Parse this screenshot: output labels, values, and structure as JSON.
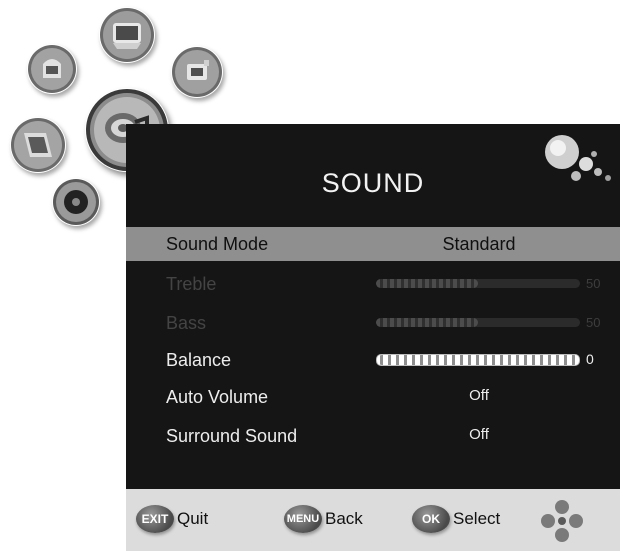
{
  "menu": {
    "title": "SOUND",
    "rows": [
      {
        "label": "Sound Mode",
        "value": "Standard"
      },
      {
        "label": "Treble",
        "value": "50",
        "level": 0.5
      },
      {
        "label": "Bass",
        "value": "50",
        "level": 0.5
      },
      {
        "label": "Balance",
        "value": "0",
        "level": 1.0
      },
      {
        "label": "Auto Volume",
        "value": "Off"
      },
      {
        "label": "Surround Sound",
        "value": "Off"
      }
    ]
  },
  "footer": {
    "exit": {
      "key": "EXIT",
      "label": "Quit"
    },
    "menu": {
      "key": "MENU",
      "label": "Back"
    },
    "ok": {
      "key": "OK",
      "label": "Select"
    }
  },
  "icons": [
    "picture-icon",
    "channel-icon",
    "setup-icon",
    "sound-icon",
    "tv-icon",
    "lock-icon"
  ],
  "colors": {
    "panel": "#151515",
    "selected_row": "#8f8f8f",
    "footer": "#dcdcdc"
  }
}
